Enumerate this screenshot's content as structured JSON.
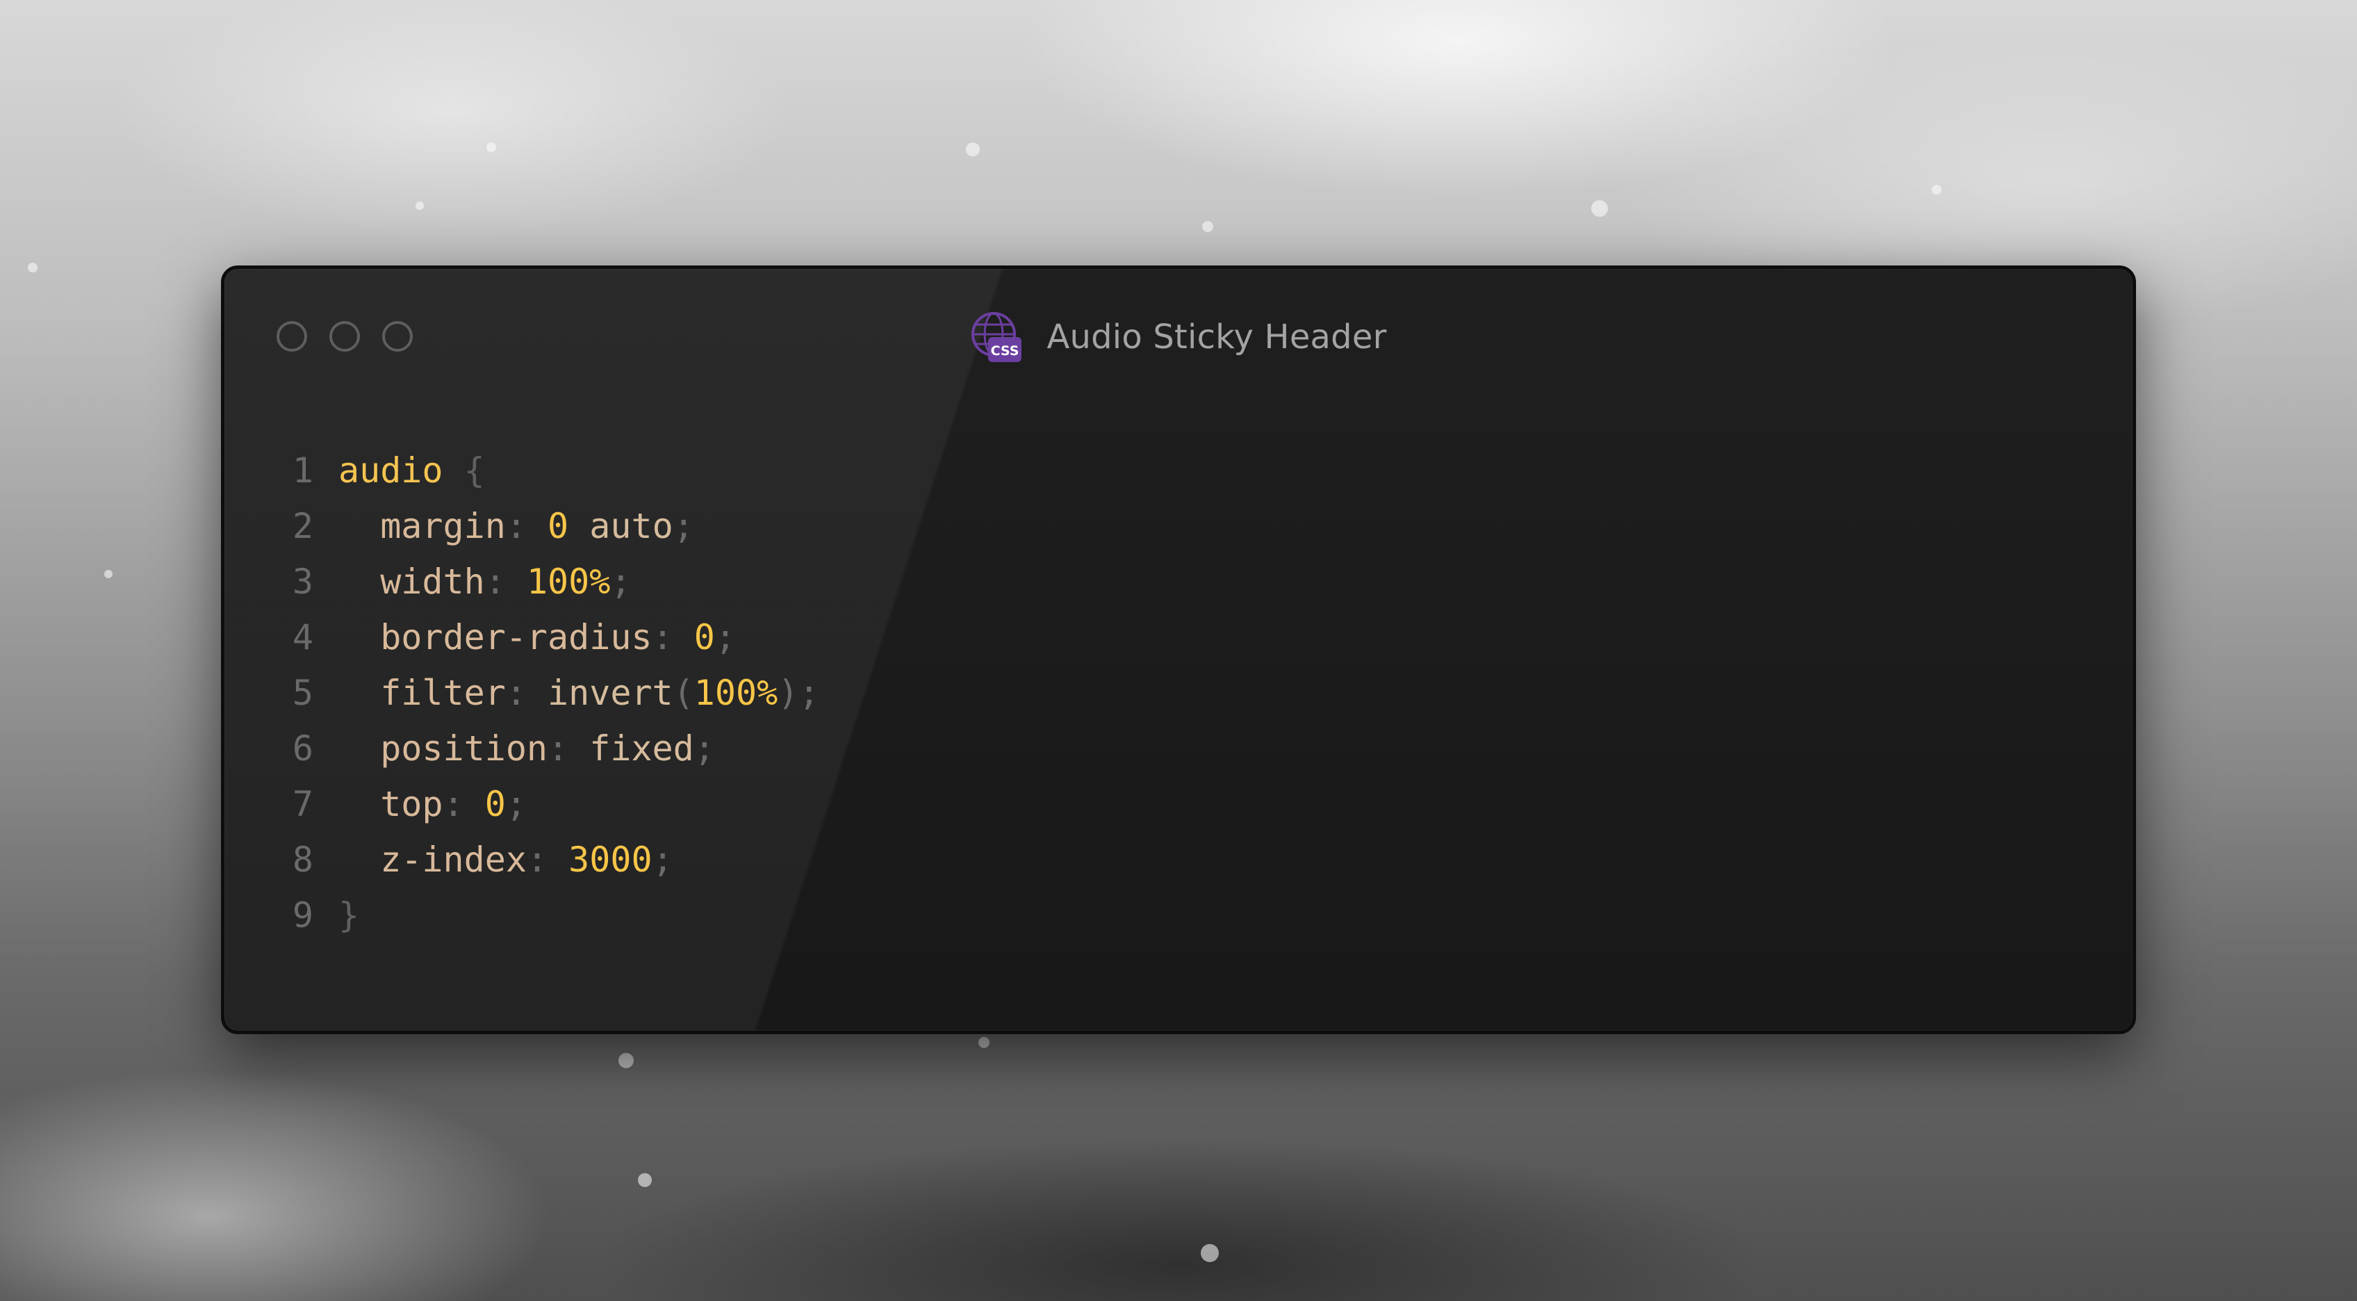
{
  "window": {
    "title": "Audio Sticky Header",
    "file_icon": "css-globe-icon",
    "traffic_lights": [
      "close",
      "minimize",
      "zoom"
    ],
    "icon_badge_text": "CSS"
  },
  "code": {
    "language": "css",
    "lines": [
      {
        "number": "1",
        "tokens": [
          {
            "text": "audio",
            "cls": "sel"
          },
          {
            "text": " ",
            "cls": "punc"
          },
          {
            "text": "{",
            "cls": "brace"
          }
        ]
      },
      {
        "number": "2",
        "tokens": [
          {
            "text": "  margin",
            "cls": "prop"
          },
          {
            "text": ": ",
            "cls": "punc"
          },
          {
            "text": "0",
            "cls": "num"
          },
          {
            "text": " ",
            "cls": "punc"
          },
          {
            "text": "auto",
            "cls": "kw"
          },
          {
            "text": ";",
            "cls": "punc"
          }
        ]
      },
      {
        "number": "3",
        "tokens": [
          {
            "text": "  width",
            "cls": "prop"
          },
          {
            "text": ": ",
            "cls": "punc"
          },
          {
            "text": "100%",
            "cls": "num"
          },
          {
            "text": ";",
            "cls": "punc"
          }
        ]
      },
      {
        "number": "4",
        "tokens": [
          {
            "text": "  border-radius",
            "cls": "prop"
          },
          {
            "text": ": ",
            "cls": "punc"
          },
          {
            "text": "0",
            "cls": "num"
          },
          {
            "text": ";",
            "cls": "punc"
          }
        ]
      },
      {
        "number": "5",
        "tokens": [
          {
            "text": "  filter",
            "cls": "prop"
          },
          {
            "text": ": ",
            "cls": "punc"
          },
          {
            "text": "invert",
            "cls": "kw"
          },
          {
            "text": "(",
            "cls": "punc"
          },
          {
            "text": "100%",
            "cls": "num"
          },
          {
            "text": ");",
            "cls": "punc"
          }
        ]
      },
      {
        "number": "6",
        "tokens": [
          {
            "text": "  position",
            "cls": "prop"
          },
          {
            "text": ": ",
            "cls": "punc"
          },
          {
            "text": "fixed",
            "cls": "kw"
          },
          {
            "text": ";",
            "cls": "punc"
          }
        ]
      },
      {
        "number": "7",
        "tokens": [
          {
            "text": "  top",
            "cls": "prop"
          },
          {
            "text": ": ",
            "cls": "punc"
          },
          {
            "text": "0",
            "cls": "num"
          },
          {
            "text": ";",
            "cls": "punc"
          }
        ]
      },
      {
        "number": "8",
        "tokens": [
          {
            "text": "  z-index",
            "cls": "prop"
          },
          {
            "text": ": ",
            "cls": "punc"
          },
          {
            "text": "3000",
            "cls": "num"
          },
          {
            "text": ";",
            "cls": "punc"
          }
        ]
      },
      {
        "number": "9",
        "tokens": [
          {
            "text": "}",
            "cls": "brace"
          }
        ]
      }
    ]
  },
  "colors": {
    "selector": "#f5c451",
    "property": "#d8b99a",
    "number": "#f7c548",
    "keyword": "#d6bc9d",
    "punctuation": "#6b6b6b",
    "line_number": "#6a6a6a",
    "window_bg": "#1f1f1f",
    "icon_purple": "#6b3fa0"
  }
}
